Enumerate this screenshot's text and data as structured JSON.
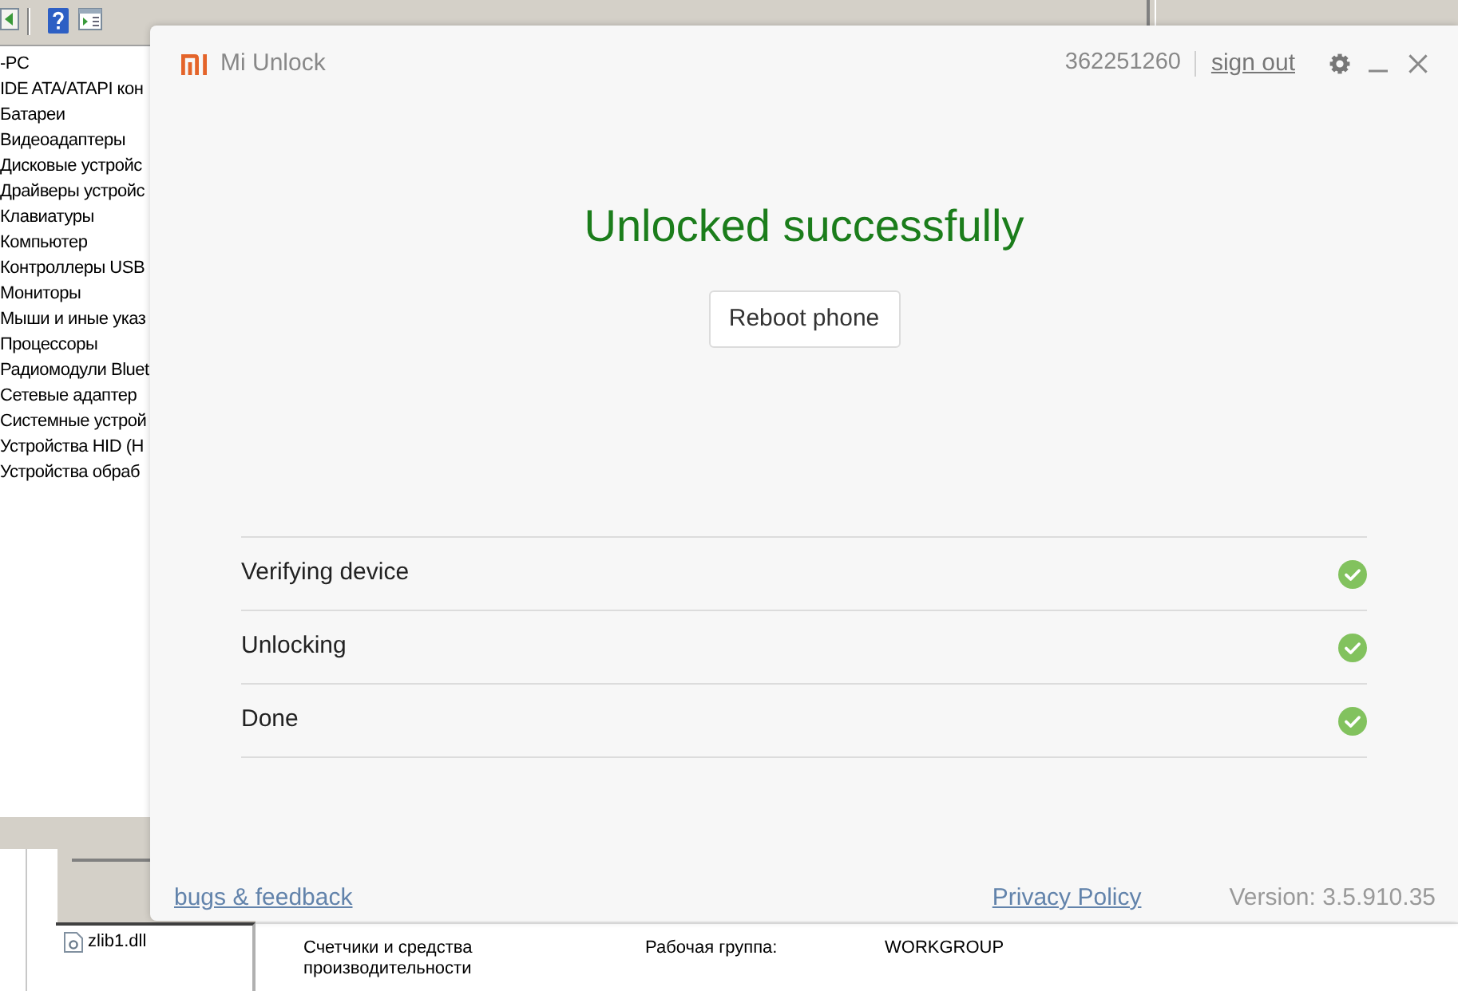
{
  "background_window": {
    "device_tree": [
      "-PC",
      "IDE ATA/ATAPI кон",
      "Батареи",
      "Видеоадаптеры",
      "Дисковые устройс",
      "Драйверы устройс",
      "Клавиатуры",
      "Компьютер",
      "Контроллеры USB",
      "Мониторы",
      "Мыши и иные указ",
      "Процессоры",
      "Радиомодули Bluet",
      "Сетевые адаптер",
      "Системные устрой",
      "Устройства HID (H",
      "Устройства обраб"
    ],
    "files": [
      "zlib1.dll"
    ],
    "system_info": {
      "performance_label": "Счетчики и средства производительности",
      "workgroup_label": "Рабочая группа:",
      "workgroup_value": "WORKGROUP"
    }
  },
  "app": {
    "title": "Mi Unlock",
    "account_id": "362251260",
    "sign_out": "sign out",
    "heading": "Unlocked successfully",
    "reboot_button": "Reboot phone",
    "steps": [
      {
        "label": "Verifying device",
        "done": true
      },
      {
        "label": "Unlocking",
        "done": true
      },
      {
        "label": "Done",
        "done": true
      }
    ],
    "footer": {
      "feedback_link": "bugs & feedback",
      "privacy_link": "Privacy Policy",
      "version": "Version: 3.5.910.35"
    }
  }
}
